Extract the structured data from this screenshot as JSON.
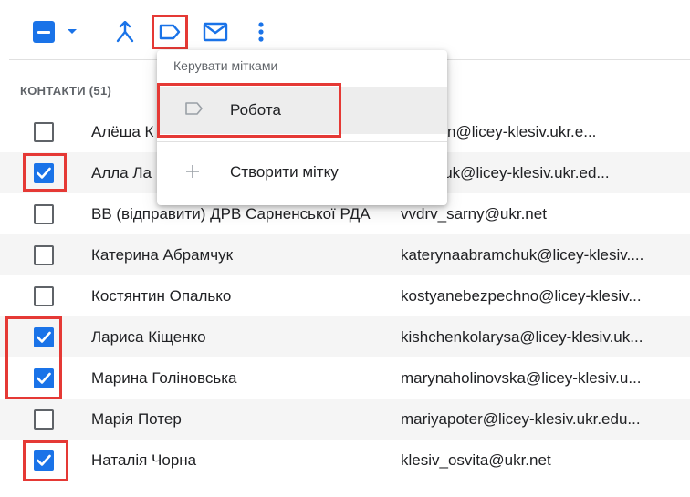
{
  "menu": {
    "title": "Керувати мітками",
    "items": [
      {
        "label": "Робота",
        "icon": "label-outline-icon"
      },
      {
        "label": "Створити мітку",
        "icon": "plus-icon"
      }
    ]
  },
  "contacts": {
    "header": "КОНТАКТИ (51)",
    "rows": [
      {
        "name": "Алёша К",
        "email": "vkorpan@licey-klesiv.ukr.e...",
        "checked": false
      },
      {
        "name": "Алла Ла",
        "email": "marchuk@licey-klesiv.ukr.ed...",
        "checked": true
      },
      {
        "name": "ВВ (відправити) ДРВ Сарненської РДА",
        "email": "vvdrv_sarny@ukr.net",
        "checked": false
      },
      {
        "name": "Катерина Абрамчук",
        "email": "katerynaabramchuk@licey-klesiv....",
        "checked": false
      },
      {
        "name": "Костянтин Опалько",
        "email": "kostyanebezpechno@licey-klesiv...",
        "checked": false
      },
      {
        "name": "Лариса Кіщенко",
        "email": "kishchenkolarysa@licey-klesiv.uk...",
        "checked": true
      },
      {
        "name": "Марина Голіновська",
        "email": "marynaholinovska@licey-klesiv.u...",
        "checked": true
      },
      {
        "name": "Марія Потер",
        "email": "mariyapoter@licey-klesiv.ukr.edu...",
        "checked": false
      },
      {
        "name": "Наталія Чорна",
        "email": "klesiv_osvita@ukr.net",
        "checked": true
      }
    ]
  },
  "colors": {
    "accent": "#1a73e8",
    "highlight": "#e53935"
  }
}
